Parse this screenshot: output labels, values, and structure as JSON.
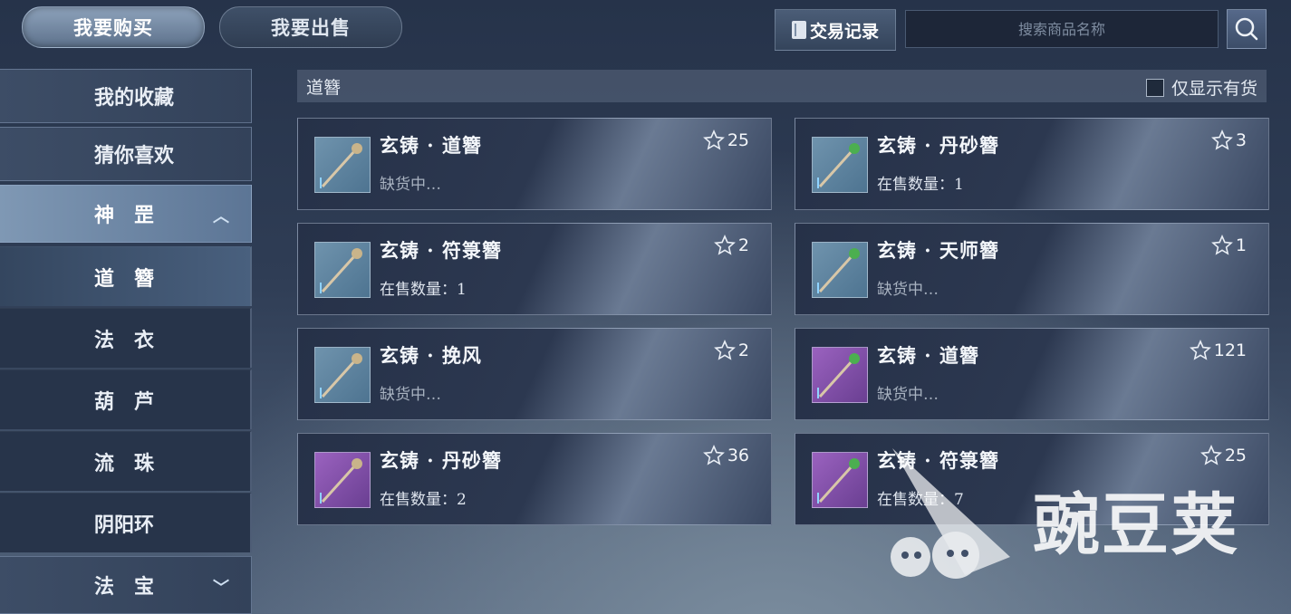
{
  "top_tabs": {
    "buy": "我要购买",
    "sell": "我要出售"
  },
  "record_button": "交易记录",
  "search": {
    "placeholder": "搜索商品名称",
    "icon": "search-icon"
  },
  "sidebar": {
    "favorites": "我的收藏",
    "recommend": "猜你喜欢",
    "category": "神　罡",
    "sub_items": [
      "道　簪",
      "法　衣",
      "葫　芦",
      "流　珠",
      "阴阳环"
    ],
    "bottom_category": "法　宝"
  },
  "filter": {
    "title": "道簪",
    "instock_label": "仅显示有货"
  },
  "items": [
    {
      "name": "玄铸 · 道簪",
      "status": "缺货中…",
      "fav": "25",
      "rarity": "blue"
    },
    {
      "name": "玄铸 · 丹砂簪",
      "status": "在售数量：1",
      "fav": "3",
      "rarity": "blue"
    },
    {
      "name": "玄铸 · 符箓簪",
      "status": "在售数量：1",
      "fav": "2",
      "rarity": "blue"
    },
    {
      "name": "玄铸 · 天师簪",
      "status": "缺货中…",
      "fav": "1",
      "rarity": "blue"
    },
    {
      "name": "玄铸 · 挽风",
      "status": "缺货中…",
      "fav": "2",
      "rarity": "blue"
    },
    {
      "name": "玄铸 · 道簪",
      "status": "缺货中…",
      "fav": "121",
      "rarity": "purple"
    },
    {
      "name": "玄铸 · 丹砂簪",
      "status": "在售数量：2",
      "fav": "36",
      "rarity": "purple"
    },
    {
      "name": "玄铸 · 符箓簪",
      "status": "在售数量：7",
      "fav": "25",
      "rarity": "purple"
    }
  ],
  "watermark": "豌豆荚",
  "colors": {
    "blue_rarity": "#5f86a3",
    "purple_rarity": "#8a55b3",
    "accent": "#8ea3bc"
  }
}
